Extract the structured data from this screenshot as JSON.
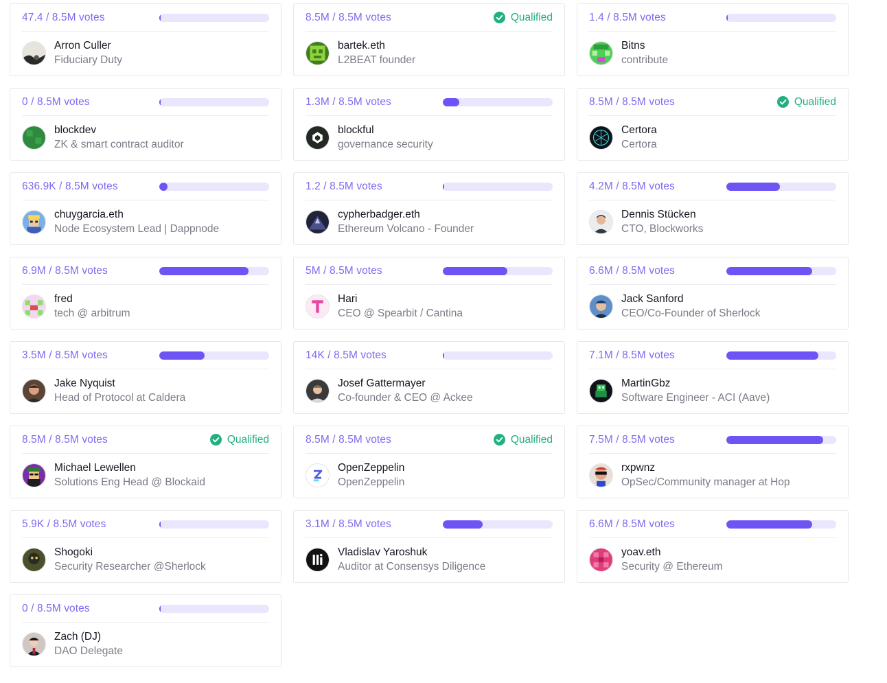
{
  "colors": {
    "accent": "#6d55f5",
    "bar_track": "#e9e6fd",
    "vote_text": "#7c6cf0",
    "qualified": "#22b07f",
    "name_text": "#161622",
    "role_text": "#7b7b88"
  },
  "qualified_label": "Qualified",
  "delegates": [
    {
      "votes": "47.4 / 8.5M votes",
      "progress": 0.0,
      "qualified": false,
      "name": "Arron Culler",
      "role": "Fiduciary Duty",
      "avatar": "arron-culler-avatar"
    },
    {
      "votes": "8.5M / 8.5M votes",
      "progress": 1.0,
      "qualified": true,
      "name": "bartek.eth",
      "role": "L2BEAT founder",
      "avatar": "bartek-eth-avatar"
    },
    {
      "votes": "1.4 / 8.5M votes",
      "progress": 0.0,
      "qualified": false,
      "name": "Bitns",
      "role": "contribute",
      "avatar": "bitns-avatar"
    },
    {
      "votes": "0 / 8.5M votes",
      "progress": 0.0,
      "qualified": false,
      "name": "blockdev",
      "role": "ZK & smart contract auditor",
      "avatar": "blockdev-avatar"
    },
    {
      "votes": "1.3M / 8.5M votes",
      "progress": 0.15,
      "qualified": false,
      "name": "blockful",
      "role": "governance security",
      "avatar": "blockful-avatar"
    },
    {
      "votes": "8.5M / 8.5M votes",
      "progress": 1.0,
      "qualified": true,
      "name": "Certora",
      "role": "Certora",
      "avatar": "certora-avatar"
    },
    {
      "votes": "636.9K / 8.5M votes",
      "progress": 0.075,
      "qualified": false,
      "name": "chuygarcia.eth",
      "role": "Node Ecosystem Lead | Dappnode",
      "avatar": "chuygarcia-eth-avatar"
    },
    {
      "votes": "1.2 / 8.5M votes",
      "progress": 0.0,
      "qualified": false,
      "name": "cypherbadger.eth",
      "role": "Ethereum Volcano - Founder",
      "avatar": "cypherbadger-eth-avatar"
    },
    {
      "votes": "4.2M / 8.5M votes",
      "progress": 0.49,
      "qualified": false,
      "name": "Dennis Stücken",
      "role": "CTO, Blockworks",
      "avatar": "dennis-stucken-avatar"
    },
    {
      "votes": "6.9M / 8.5M votes",
      "progress": 0.81,
      "qualified": false,
      "name": "fred",
      "role": "tech @ arbitrum",
      "avatar": "fred-avatar"
    },
    {
      "votes": "5M / 8.5M votes",
      "progress": 0.59,
      "qualified": false,
      "name": "Hari",
      "role": "CEO @ Spearbit / Cantina",
      "avatar": "hari-avatar"
    },
    {
      "votes": "6.6M / 8.5M votes",
      "progress": 0.78,
      "qualified": false,
      "name": "Jack Sanford",
      "role": "CEO/Co-Founder of Sherlock",
      "avatar": "jack-sanford-avatar"
    },
    {
      "votes": "3.5M / 8.5M votes",
      "progress": 0.41,
      "qualified": false,
      "name": "Jake Nyquist",
      "role": "Head of Protocol at Caldera",
      "avatar": "jake-nyquist-avatar"
    },
    {
      "votes": "14K / 8.5M votes",
      "progress": 0.0,
      "qualified": false,
      "name": "Josef Gattermayer",
      "role": "Co-founder & CEO @ Ackee",
      "avatar": "josef-gattermayer-avatar"
    },
    {
      "votes": "7.1M / 8.5M votes",
      "progress": 0.84,
      "qualified": false,
      "name": "MartinGbz",
      "role": "Software Engineer - ACI (Aave)",
      "avatar": "martingbz-avatar"
    },
    {
      "votes": "8.5M / 8.5M votes",
      "progress": 1.0,
      "qualified": true,
      "name": "Michael Lewellen",
      "role": "Solutions Eng Head @ Blockaid",
      "avatar": "michael-lewellen-avatar"
    },
    {
      "votes": "8.5M / 8.5M votes",
      "progress": 1.0,
      "qualified": true,
      "name": "OpenZeppelin",
      "role": "OpenZeppelin",
      "avatar": "openzeppelin-avatar"
    },
    {
      "votes": "7.5M / 8.5M votes",
      "progress": 0.88,
      "qualified": false,
      "name": "rxpwnz",
      "role": "OpSec/Community manager at Hop",
      "avatar": "rxpwnz-avatar"
    },
    {
      "votes": "5.9K / 8.5M votes",
      "progress": 0.0,
      "qualified": false,
      "name": "Shogoki",
      "role": "Security Researcher @Sherlock",
      "avatar": "shogoki-avatar"
    },
    {
      "votes": "3.1M / 8.5M votes",
      "progress": 0.365,
      "qualified": false,
      "name": "Vladislav Yaroshuk",
      "role": "Auditor at Consensys Diligence",
      "avatar": "vladislav-yaroshuk-avatar"
    },
    {
      "votes": "6.6M / 8.5M votes",
      "progress": 0.78,
      "qualified": false,
      "name": "yoav.eth",
      "role": "Security @ Ethereum",
      "avatar": "yoav-eth-avatar"
    },
    {
      "votes": "0 / 8.5M votes",
      "progress": 0.0,
      "qualified": false,
      "name": "Zach (DJ)",
      "role": "DAO Delegate",
      "avatar": "zach-dj-avatar"
    }
  ]
}
